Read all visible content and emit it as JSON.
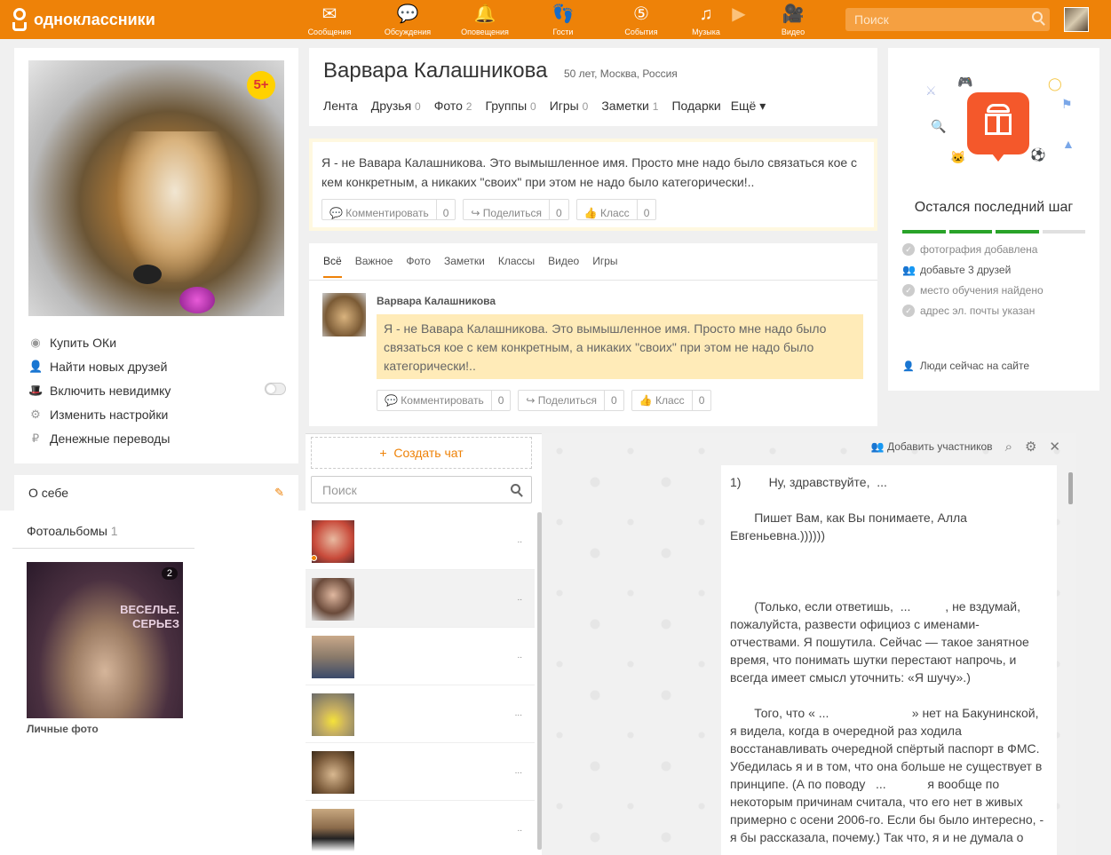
{
  "topbar": {
    "logo": "одноклассники",
    "nav": [
      {
        "label": "Сообщения",
        "icon": "envelope-icon"
      },
      {
        "label": "Обсуждения",
        "icon": "speech-bubbles-icon"
      },
      {
        "label": "Оповещения",
        "icon": "bell-icon"
      },
      {
        "label": "Гости",
        "icon": "footprints-icon"
      },
      {
        "label": "События",
        "icon": "events-icon"
      },
      {
        "label": "Музыка",
        "icon": "music-note-icon"
      },
      {
        "label": "Видео",
        "icon": "video-camera-icon"
      }
    ],
    "search_placeholder": "Поиск",
    "accent": "#ee8208"
  },
  "left": {
    "badge": "5+",
    "menu": [
      {
        "label": "Купить ОКи",
        "icon": "ok-coin-icon"
      },
      {
        "label": "Найти новых друзей",
        "icon": "person-icon"
      },
      {
        "label": "Включить невидимку",
        "icon": "hat-icon"
      },
      {
        "label": "Изменить настройки",
        "icon": "gear-icon"
      },
      {
        "label": "Денежные переводы",
        "icon": "money-transfer-icon"
      }
    ],
    "about": "О себе",
    "albums_label": "Фотоальбомы",
    "albums_count": "1",
    "album": {
      "count": "2",
      "caption": "Личные фото",
      "photo_text": "ВЕСЕЛЬЕ.\nСЕРЬЕЗ"
    }
  },
  "profile": {
    "name": "Варвара Калашникова",
    "meta": "50 лет, Москва, Россия",
    "tabs": [
      {
        "label": "Лента",
        "count": ""
      },
      {
        "label": "Друзья",
        "count": "0"
      },
      {
        "label": "Фото",
        "count": "2"
      },
      {
        "label": "Группы",
        "count": "0"
      },
      {
        "label": "Игры",
        "count": "0"
      },
      {
        "label": "Заметки",
        "count": "1"
      },
      {
        "label": "Подарки",
        "count": ""
      },
      {
        "label": "Ещё ▾",
        "count": ""
      }
    ]
  },
  "status": {
    "text": "Я - не Вавара Калашникова. Это вымышленное имя. Просто мне надо было связаться кое с кем конкретным, а никаких \"своих\" при этом не надо было категорически!..",
    "actions": [
      {
        "label": "Комментировать",
        "count": "0"
      },
      {
        "label": "Поделиться",
        "count": "0"
      },
      {
        "label": "Класс",
        "count": "0"
      }
    ]
  },
  "feed": {
    "tabs": [
      "Всё",
      "Важное",
      "Фото",
      "Заметки",
      "Классы",
      "Видео",
      "Игры"
    ],
    "author": "Варвара Калашникова",
    "text": "Я - не Вавара Калашникова. Это вымышленное имя. Просто мне надо было связаться кое с кем конкретным, а никаких \"своих\" при этом не надо было категорически!..",
    "actions": [
      {
        "label": "Комментировать",
        "count": "0"
      },
      {
        "label": "Поделиться",
        "count": "0"
      },
      {
        "label": "Класс",
        "count": "0"
      }
    ]
  },
  "steps": {
    "title": "Остался последний шаг",
    "progress_done": 3,
    "progress_total": 4,
    "items": [
      {
        "label": "фотография добавлена",
        "done": true
      },
      {
        "label": "добавьте 3 друзей",
        "done": false
      },
      {
        "label": "место обучения найдено",
        "done": true
      },
      {
        "label": "адрес эл. почты указан",
        "done": true
      }
    ],
    "online_link": "Люди сейчас на сайте"
  },
  "chat": {
    "create": "Создать чат",
    "search_placeholder": "Поиск",
    "add_participants": "Добавить участников",
    "rows_dots": [
      "..",
      "..",
      "..",
      "...",
      "...",
      ".."
    ],
    "message": [
      "1)        Ну, здравствуйте,  ...",
      "",
      "       Пишет Вам, как Вы понимаете, Алла Евгеньевна.))))))",
      "",
      "",
      "",
      "       (Только, если ответишь,  ...          , не вздумай, пожалуйста, развести официоз с именами-отчествами. Я пошутила. Сейчас — такое занятное время, что понимать шутки перестают напрочь, и всегда имеет смысл уточнить: «Я шучу».)",
      "",
      "       Того, что « ...                        » нет на Бакунинской, я видела, когда в очередной раз ходила восстанавливать очередной спёртый паспорт в ФМС. Убедилась я и в том, что она больше не существует в принципе. (А по поводу   ...            я вообще по некоторым причинам считала, что его нет в живых примерно с осени 2006-го. Если бы было интересно, - я бы рассказала, почему.) Так что, я и не думала о"
    ]
  }
}
